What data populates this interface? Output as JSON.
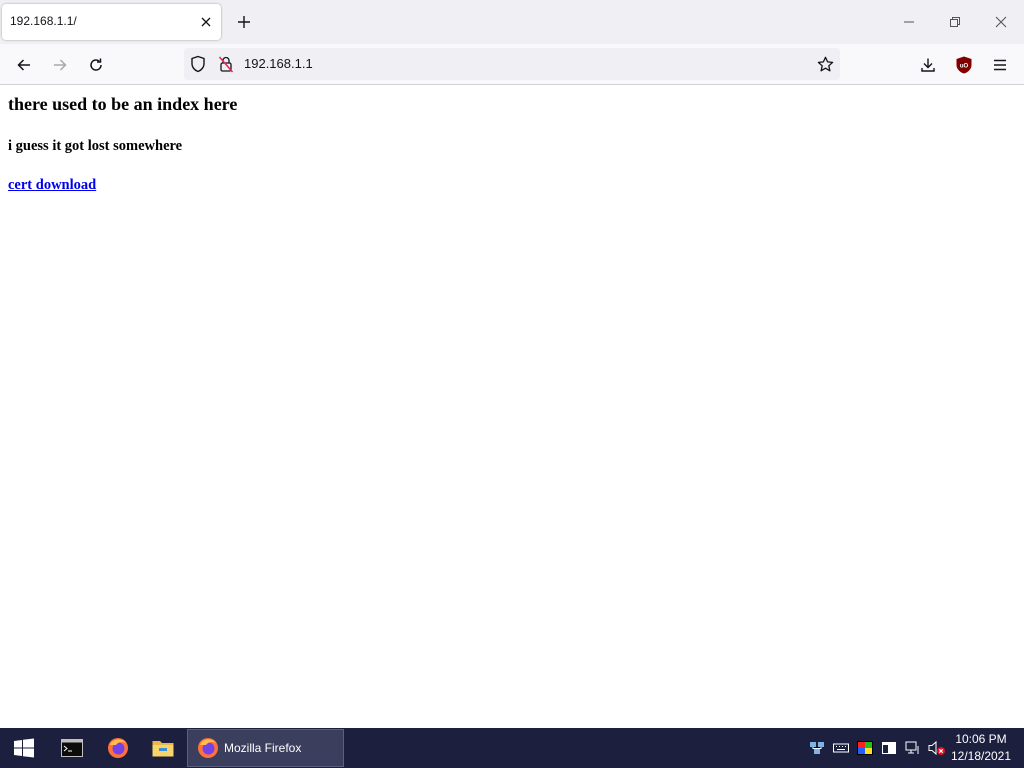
{
  "browser": {
    "tab": {
      "title": "192.168.1.1/"
    },
    "url": "192.168.1.1",
    "colors": {
      "tabstrip": "#f0f0f4",
      "toolbar": "#f9f9fb",
      "ublock": "#800000"
    }
  },
  "page": {
    "heading": "there used to be an index here",
    "subheading": "i guess it got lost somewhere",
    "link": "cert download"
  },
  "taskbar": {
    "pinned": [
      "windows-start-icon",
      "terminal-icon",
      "firefox-icon",
      "file-explorer-icon"
    ],
    "active_window": "Mozilla Firefox",
    "clock": {
      "time": "10:06 PM",
      "date": "12/18/2021"
    }
  }
}
